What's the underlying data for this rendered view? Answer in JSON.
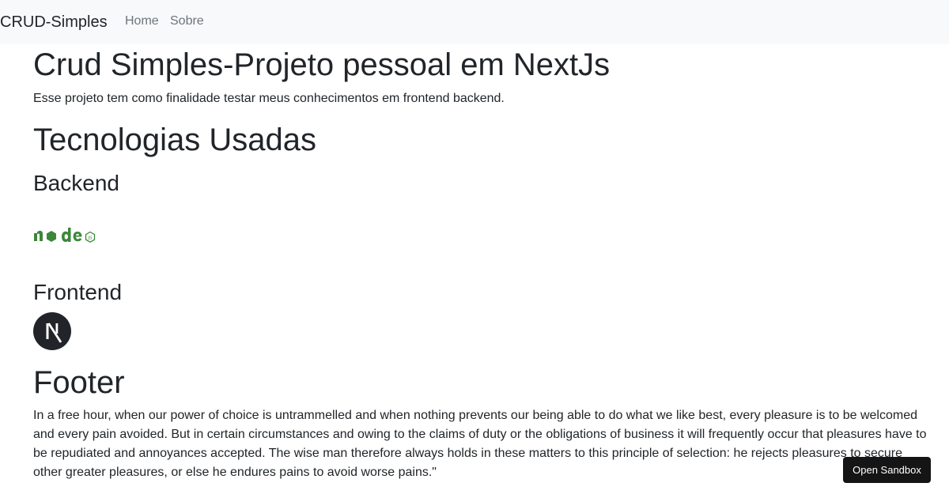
{
  "navbar": {
    "brand": "CRUD-Simples",
    "links": [
      "Home",
      "Sobre"
    ]
  },
  "main": {
    "title": "Crud Simples-Projeto pessoal em NextJs",
    "intro": "Esse projeto tem como finalidade testar meus conhecimentos em frontend backend.",
    "tech_heading": "Tecnologias Usadas",
    "backend_heading": "Backend",
    "backend_logo": {
      "icon": "nodejs-logo",
      "text": "node",
      "color": "#3c873a"
    },
    "frontend_heading": "Frontend",
    "frontend_logo": {
      "icon": "nextjs-logo",
      "text": "N",
      "color": "#212529"
    },
    "footer_heading": "Footer",
    "footer_text": "In a free hour, when our power of choice is untrammelled and when nothing prevents our being able to do what we like best, every pleasure is to be welcomed and every pain avoided. But in certain circumstances and owing to the claims of duty or the obligations of business it will frequently occur that pleasures have to be repudiated and annoyances accepted. The wise man therefore always holds in these matters to this principle of selection: he rejects pleasures to secure other greater pleasures, or else he endures pains to avoid worse pains.\""
  },
  "sandbox_button": "Open Sandbox",
  "colors": {
    "navbar_bg": "#f8f9fa",
    "text": "#212529",
    "nav_link": "#6c757d",
    "button_bg": "#151515"
  }
}
